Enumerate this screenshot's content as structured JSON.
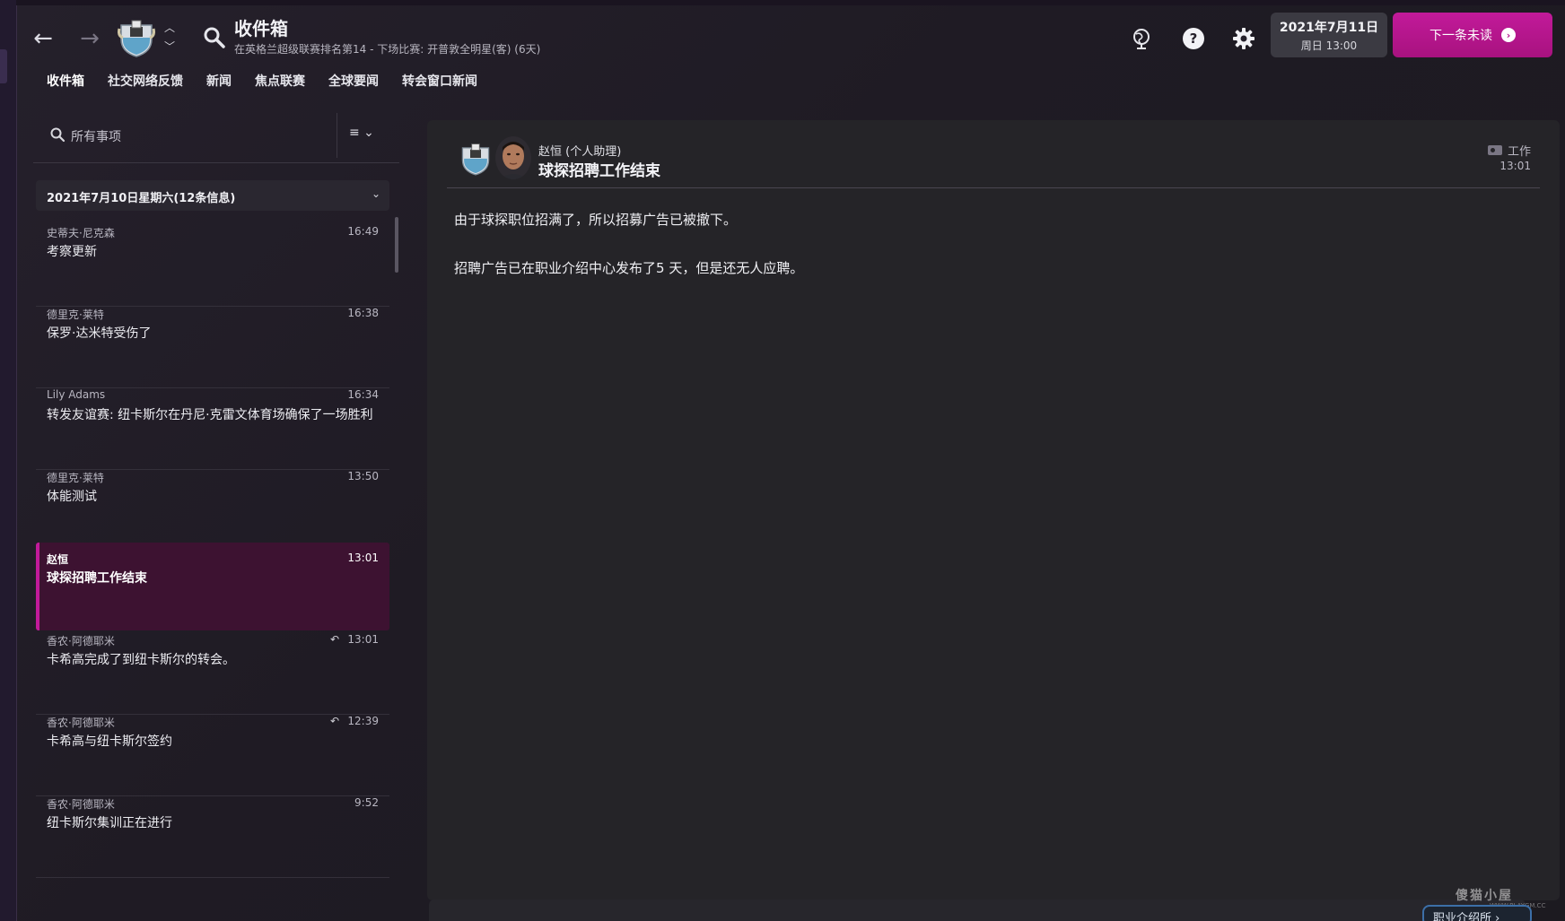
{
  "header": {
    "title": "收件箱",
    "subtitle": "在英格兰超级联赛排名第14 - 下场比赛: 开普敦全明星(客) (6天)",
    "date": "2021年7月11日",
    "day_time": "周日 13:00",
    "next_unread": "下一条未读"
  },
  "tabs": [
    {
      "label": "收件箱"
    },
    {
      "label": "社交网络反馈"
    },
    {
      "label": "新闻"
    },
    {
      "label": "焦点联赛"
    },
    {
      "label": "全球要闻"
    },
    {
      "label": "转会窗口新闻"
    }
  ],
  "search": {
    "placeholder": "所有事项"
  },
  "date_group": {
    "label": "2021年7月10日星期六(12条信息)"
  },
  "messages": [
    {
      "sender": "史蒂夫·尼克森",
      "time": "16:49",
      "subject": "考察更新"
    },
    {
      "sender": "德里克·莱特",
      "time": "16:38",
      "subject": "保罗·达米特受伤了"
    },
    {
      "sender": "Lily Adams",
      "time": "16:34",
      "subject": "转发友谊赛: 纽卡斯尔在丹尼·克雷文体育场确保了一场胜利"
    },
    {
      "sender": "德里克·莱特",
      "time": "13:50",
      "subject": "体能测试"
    },
    {
      "sender": "赵恒",
      "time": "13:01",
      "subject": "球探招聘工作结束"
    },
    {
      "sender": "香农·阿德耶米",
      "time": "13:01",
      "subject": "卡希高完成了到纽卡斯尔的转会。"
    },
    {
      "sender": "香农·阿德耶米",
      "time": "12:39",
      "subject": "卡希高与纽卡斯尔签约"
    },
    {
      "sender": "香农·阿德耶米",
      "time": "9:52",
      "subject": "纽卡斯尔集训正在进行"
    }
  ],
  "message": {
    "from": "赵恒 (个人助理)",
    "subject": "球探招聘工作结束",
    "tag": "工作",
    "time": "13:01",
    "body": [
      "由于球探职位招满了，所以招募广告已被撤下。",
      "招聘广告已在职业介绍中心发布了5 天，但是还无人应聘。"
    ]
  },
  "footer": {
    "job_center_button": "职业介绍所 ›",
    "watermark": "傻猫小屋",
    "watermark_url": "WWW.PLAYGM.CC"
  },
  "icons": {
    "back": "arrow-left-icon",
    "forward": "arrow-right-icon",
    "search": "search-icon",
    "globe": "globe-icon",
    "help": "help-icon",
    "settings": "gear-icon",
    "reply": "reply-icon",
    "tag": "tag-icon"
  },
  "colors": {
    "accent": "#c21a9a",
    "selected_bg": "#3d1231",
    "panel_bg": "#252428"
  }
}
